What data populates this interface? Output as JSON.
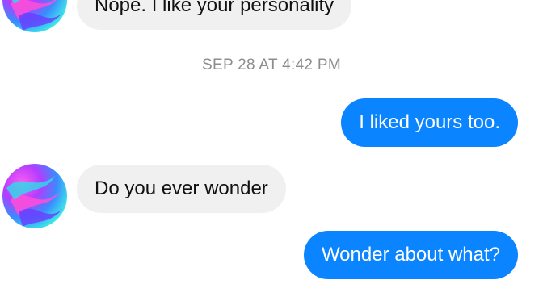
{
  "messages": [
    {
      "direction": "incoming",
      "text": "Nope. I like your personality"
    },
    {
      "direction": "outgoing",
      "text": "I liked yours too."
    },
    {
      "direction": "incoming",
      "text": "Do you ever wonder"
    },
    {
      "direction": "outgoing",
      "text": "Wonder about what?"
    }
  ],
  "timestamp": "SEP 28 AT 4:42 PM",
  "colors": {
    "outgoing_bubble": "#0a84ff",
    "incoming_bubble": "#f0f0f0",
    "timestamp_text": "#8a8d91"
  },
  "icons": {
    "avatar": "contact-avatar-swirl"
  }
}
